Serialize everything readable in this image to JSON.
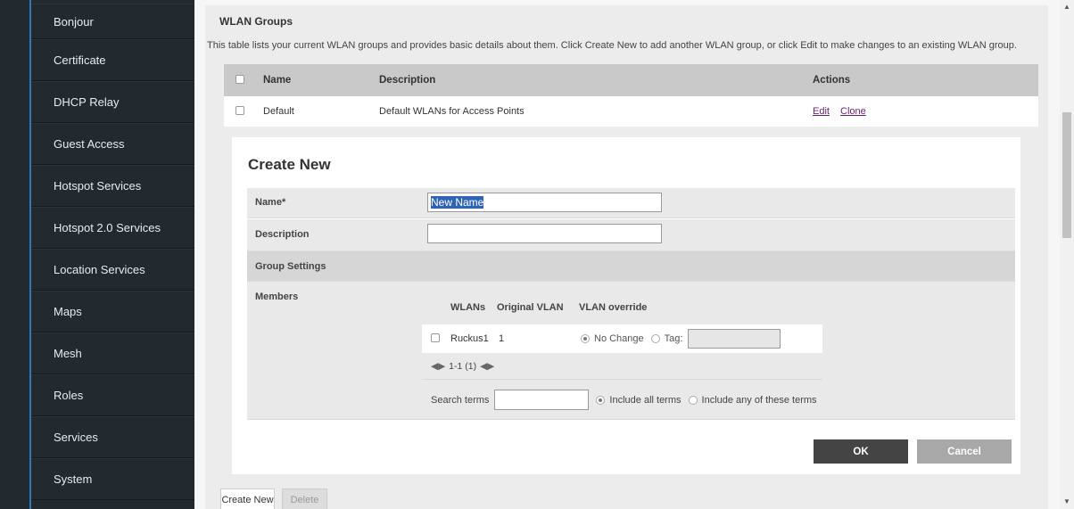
{
  "sidebar": {
    "items": [
      {
        "label": "Bonjour"
      },
      {
        "label": "Certificate"
      },
      {
        "label": "DHCP Relay"
      },
      {
        "label": "Guest Access"
      },
      {
        "label": "Hotspot Services"
      },
      {
        "label": "Hotspot 2.0 Services"
      },
      {
        "label": "Location Services"
      },
      {
        "label": "Maps"
      },
      {
        "label": "Mesh"
      },
      {
        "label": "Roles"
      },
      {
        "label": "Services"
      },
      {
        "label": "System"
      }
    ]
  },
  "section": {
    "title": "WLAN Groups",
    "description": "This table lists your current WLAN groups and provides basic details about them. Click Create New to add another WLAN group, or click Edit to make changes to an existing WLAN group."
  },
  "groups_table": {
    "headers": {
      "name": "Name",
      "description": "Description",
      "actions": "Actions"
    },
    "rows": [
      {
        "name": "Default",
        "description": "Default WLANs for Access Points",
        "edit": "Edit",
        "clone": "Clone"
      }
    ]
  },
  "create_form": {
    "title": "Create New",
    "name_label": "Name*",
    "name_value": "New Name",
    "description_label": "Description",
    "description_value": "",
    "group_settings_label": "Group Settings",
    "members_label": "Members",
    "members_table": {
      "headers": {
        "wlans": "WLANs",
        "original_vlan": "Original VLAN",
        "vlan_override": "VLAN override"
      },
      "rows": [
        {
          "wlan": "Ruckus1",
          "original_vlan": "1",
          "no_change": "No Change",
          "tag": "Tag:"
        }
      ],
      "pager": "1-1 (1)"
    },
    "search": {
      "label": "Search terms",
      "value": "",
      "include_all": "Include all terms",
      "include_any": "Include any of these terms"
    },
    "ok": "OK",
    "cancel": "Cancel"
  },
  "bottom_buttons": {
    "create_new": "Create New",
    "delete": "Delete"
  },
  "colors": {
    "sidebar_bg": "#22292f",
    "sidebar_accent": "#2f79b4",
    "link": "#6b1f6b",
    "ok_button": "#444444",
    "cancel_button": "#a8a8a8",
    "text_selection": "#2f63b6"
  }
}
